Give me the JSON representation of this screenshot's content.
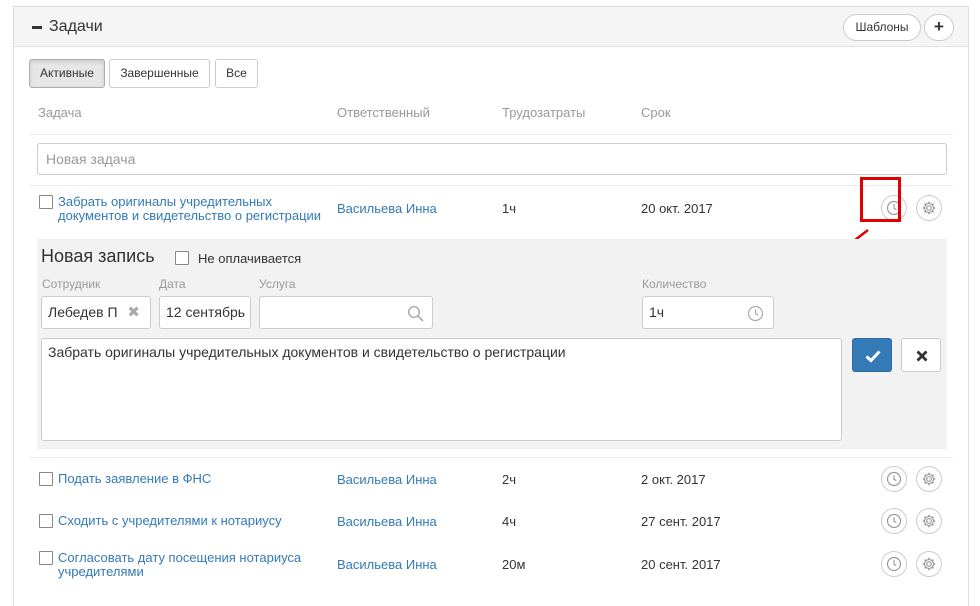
{
  "panel": {
    "title": "Задачи",
    "templates_label": "Шаблоны",
    "add_label": "+"
  },
  "tabs": [
    {
      "label": "Активные",
      "active": true
    },
    {
      "label": "Завершенные",
      "active": false
    },
    {
      "label": "Все",
      "active": false
    }
  ],
  "columns": {
    "task": "Задача",
    "responsible": "Ответственный",
    "effort": "Трудозатраты",
    "due": "Срок"
  },
  "new_task_placeholder": "Новая задача",
  "tasks": [
    {
      "title_line1": "Забрать оригиналы учредительных",
      "title_line2": "документов и свидетельство о регистрации",
      "responsible": "Васильева Инна",
      "effort": "1ч",
      "due": "20 окт. 2017"
    },
    {
      "title_line1": "Подать заявление в ФНС",
      "responsible": "Васильева Инна",
      "effort": "2ч",
      "due": "2 окт. 2017"
    },
    {
      "title_line1": "Сходить с учредителями к нотариусу",
      "responsible": "Васильева Инна",
      "effort": "4ч",
      "due": "27 сент. 2017"
    },
    {
      "title_line1": "Согласовать дату посещения нотариуса",
      "title_line2": "учредителями",
      "responsible": "Васильева Инна",
      "effort": "20м",
      "due": "20 сент. 2017"
    }
  ],
  "entry_form": {
    "title": "Новая запись",
    "not_paid_label": "Не оплачивается",
    "employee_label": "Сотрудник",
    "employee_value": "Лебедев П",
    "date_label": "Дата",
    "date_value": "12 сентябрь",
    "service_label": "Услуга",
    "service_value": "",
    "quantity_label": "Количество",
    "quantity_value": "1ч",
    "description": "Забрать оригиналы учредительных документов и свидетельство о регистрации"
  },
  "colors": {
    "link": "#337ab7",
    "primary": "#337ab7",
    "highlight": "#e00000"
  },
  "icons": [
    "minus-icon",
    "plus-icon",
    "clock-icon",
    "gear-icon",
    "search-icon",
    "clear-x-icon",
    "checkmark-icon",
    "close-icon",
    "arrow-annotation"
  ]
}
